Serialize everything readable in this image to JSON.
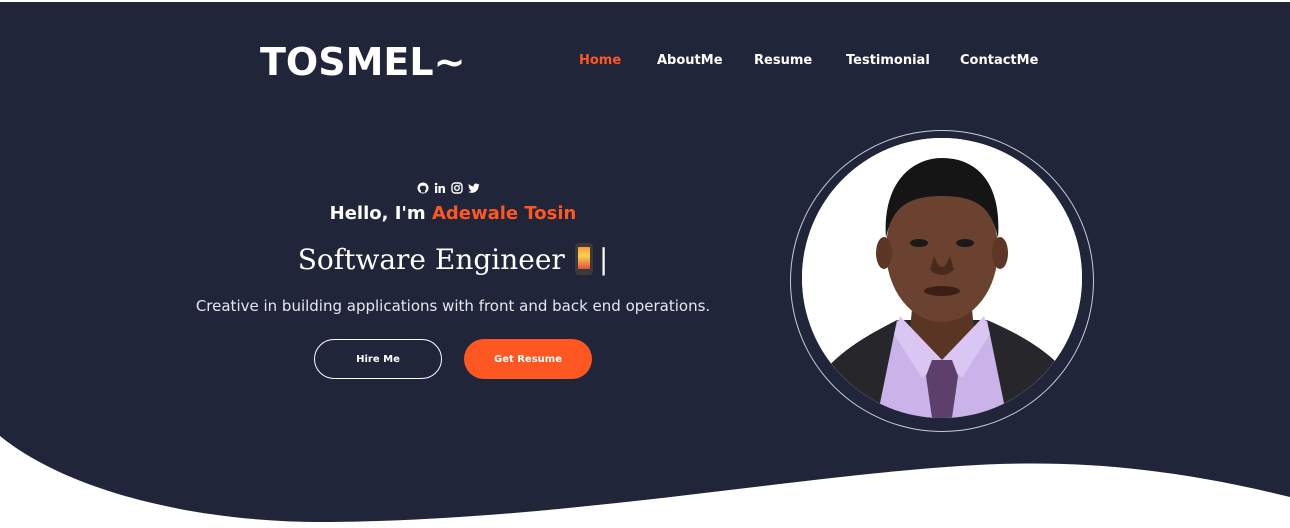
{
  "brand": {
    "logo": "TOSMEL~"
  },
  "nav": {
    "items": [
      {
        "label": "Home",
        "active": true
      },
      {
        "label": "AboutMe",
        "active": false
      },
      {
        "label": "Resume",
        "active": false
      },
      {
        "label": "Testimonial",
        "active": false
      },
      {
        "label": "ContactMe",
        "active": false
      }
    ]
  },
  "social": [
    "github-icon",
    "linkedin-icon",
    "instagram-icon",
    "twitter-icon"
  ],
  "hero": {
    "greeting": "Hello, I'm ",
    "name": "Adewale Tosin",
    "role": "Software Engineer",
    "cursor": "|",
    "tagline": "Creative in building applications with front and back end operations.",
    "hire_label": "Hire Me",
    "resume_label": "Get Resume"
  },
  "colors": {
    "background": "#20253a",
    "accent": "#ff5722",
    "text": "#ffffff"
  }
}
